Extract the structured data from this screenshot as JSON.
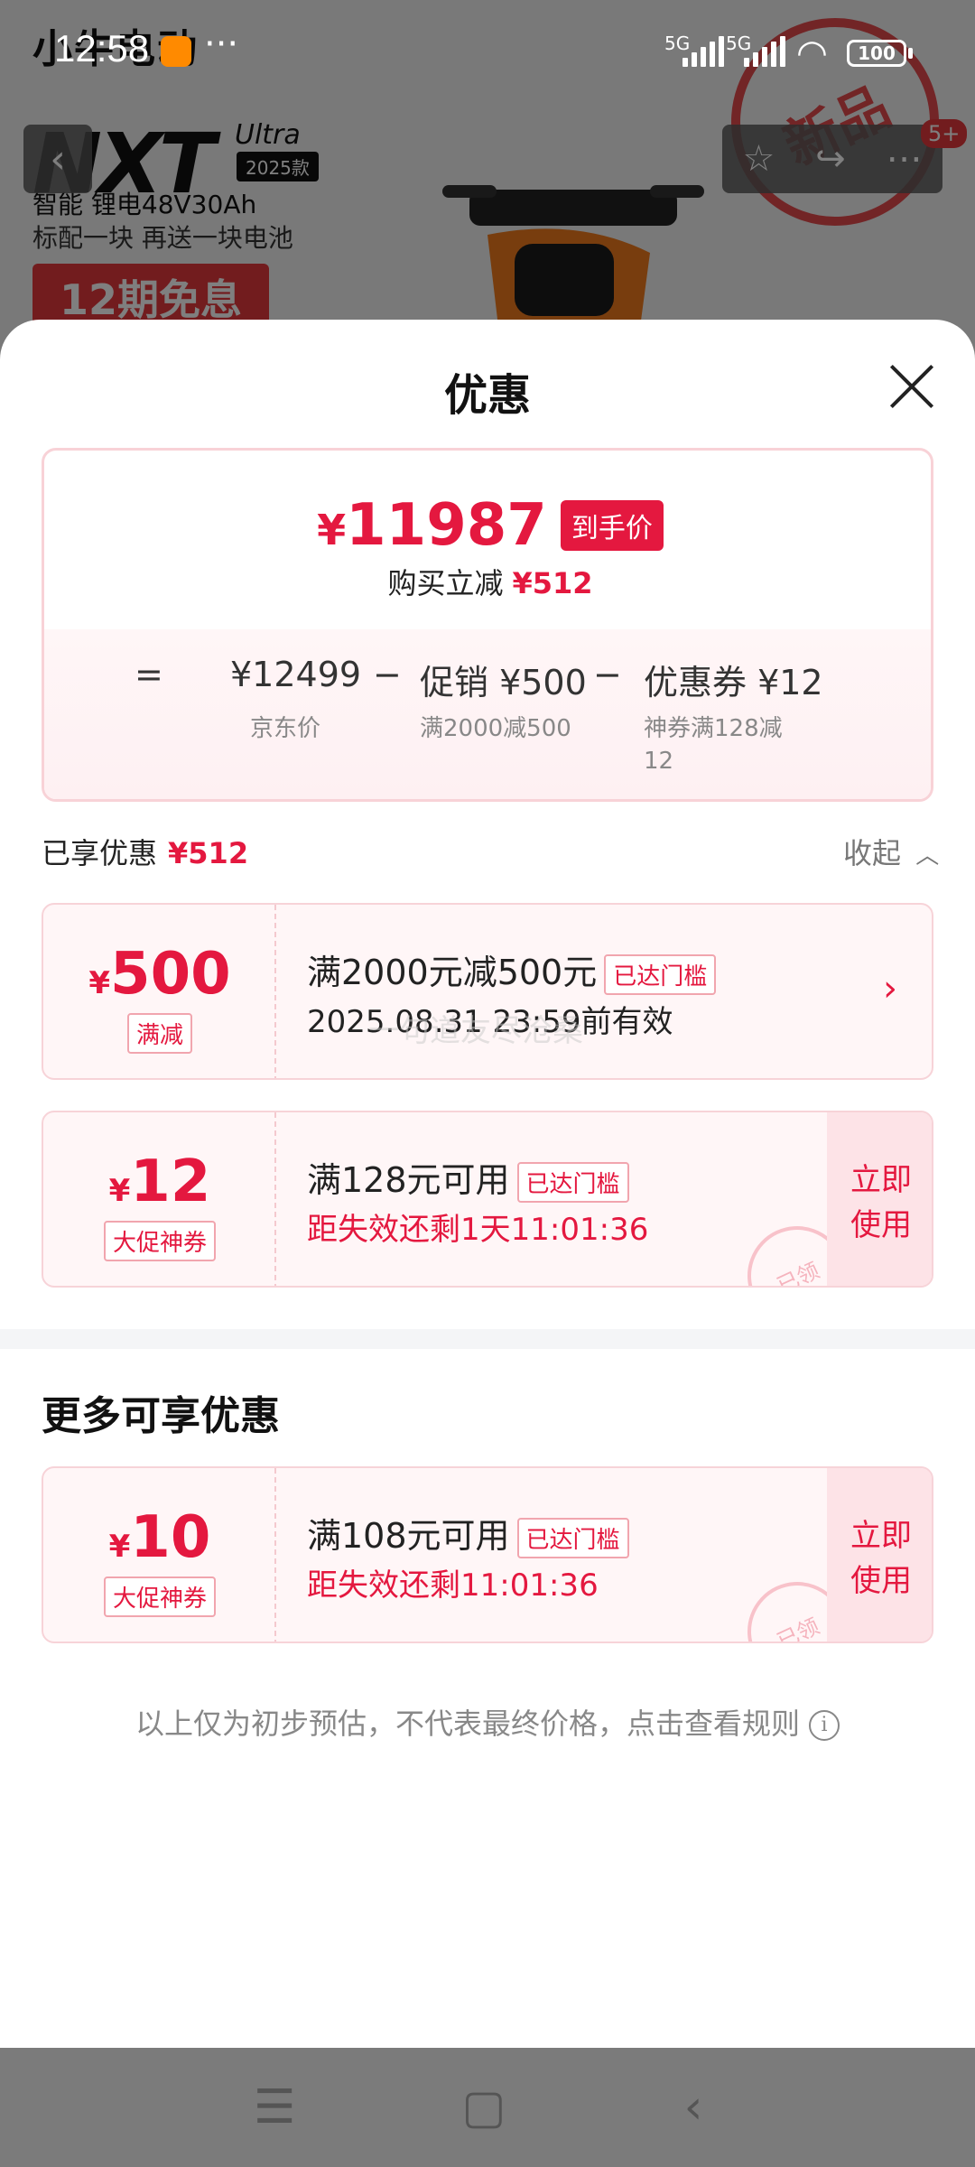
{
  "status_bar": {
    "time": "12:58",
    "more": "···",
    "signal1": "5G",
    "signal2": "5G",
    "battery": "100"
  },
  "background": {
    "brand": "小牛电动",
    "model": "NXT",
    "model_sub": "Ultra",
    "model_year": "2025款",
    "spec_line1": "智能 锂电48V30Ah",
    "spec_line2": "标配一块 再送一块电池",
    "promo_tag": "12期免息",
    "stamp": "新品",
    "cart_badge": "5+"
  },
  "sheet": {
    "title": "优惠"
  },
  "price_card": {
    "currency": "¥",
    "final_price": "11987",
    "final_tag": "到手价",
    "reduce_label": "购买立减",
    "reduce_amount": "¥512",
    "calc": {
      "equals": "=",
      "base_price": "¥12499",
      "base_label": "京东价",
      "minus1": "−",
      "promo_value": "促销 ¥500",
      "promo_label": "满2000减500",
      "minus2": "−",
      "coupon_value": "优惠券 ¥12",
      "coupon_label_line1": "神券满128减",
      "coupon_label_line2": "12"
    }
  },
  "enjoyed": {
    "label": "已享优惠",
    "amount": "¥512",
    "collapse_label": "收起"
  },
  "coupons": [
    {
      "currency": "¥",
      "amount": "500",
      "type": "满减",
      "condition": "满2000元减500元",
      "reached": "已达门槛",
      "expire": "2025.08.31 23:59前有效"
    },
    {
      "currency": "¥",
      "amount": "12",
      "type": "大促神券",
      "condition": "满128元可用",
      "reached": "已达门槛",
      "expire": "距失效还剩1天11:01:36",
      "use_line1": "立即",
      "use_line2": "使用",
      "stamp": "已领"
    }
  ],
  "more_section": {
    "title": "更多可享优惠",
    "coupons": [
      {
        "currency": "¥",
        "amount": "10",
        "type": "大促神券",
        "condition": "满108元可用",
        "reached": "已达门槛",
        "expire": "距失效还剩11:01:36",
        "use_line1": "立即",
        "use_line2": "使用",
        "stamp": "已领"
      }
    ]
  },
  "watermark": "一句道友尽沧桑",
  "disclaimer": "以上仅为初步预估，不代表最终价格，点击查看规则",
  "icons": {
    "close": "close-icon",
    "info": "info-icon",
    "chevron_up": "chevron-up-icon",
    "chevron_right": "chevron-right-icon"
  },
  "colors": {
    "accent": "#e4183f",
    "card_bg": "#fff6f7"
  }
}
